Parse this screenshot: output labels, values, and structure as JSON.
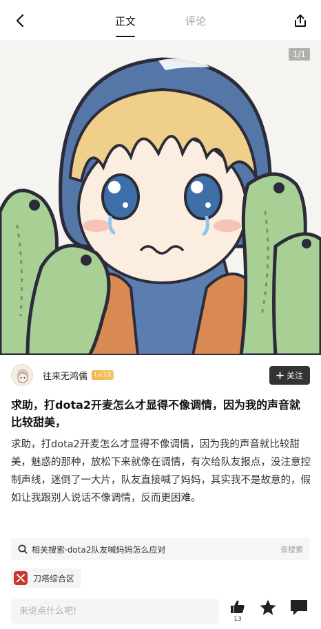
{
  "header": {
    "tabs": [
      {
        "label": "正文",
        "active": true
      },
      {
        "label": "评论",
        "active": false
      }
    ],
    "icons": {
      "back": "back-arrow-icon",
      "share": "share-icon"
    }
  },
  "media": {
    "page_indicator": "1/1"
  },
  "author": {
    "name": "往来无鸿儒",
    "level": "Lv.13",
    "follow_label": "关注"
  },
  "post": {
    "title": "求助，打dota2开麦怎么才显得不像调情，因为我的声音就比较甜美，",
    "body": "求助，打dota2开麦怎么才显得不像调情，因为我的声音就比较甜美，魅惑的那种，放松下来就像在调情，有次给队友报点，没注意控制声线，迷倒了一大片，队友直接喊了妈妈，其实我不是故意的，假如让我跟别人说话不像调情，反而更困难。"
  },
  "related_search": {
    "text": "相关搜索·dota2队友喊妈妈怎么应对",
    "action": "去搜索"
  },
  "circle": {
    "label": "刀塔综合区",
    "accent": "#c8362f"
  },
  "bottom_bar": {
    "comment_placeholder": "来说点什么吧!",
    "like_count": "13"
  },
  "colors": {
    "follow_button": "#333333",
    "level_badge": "#f5b14a",
    "frog_green": "#a8cf94",
    "hood_blue": "#5577a8"
  }
}
